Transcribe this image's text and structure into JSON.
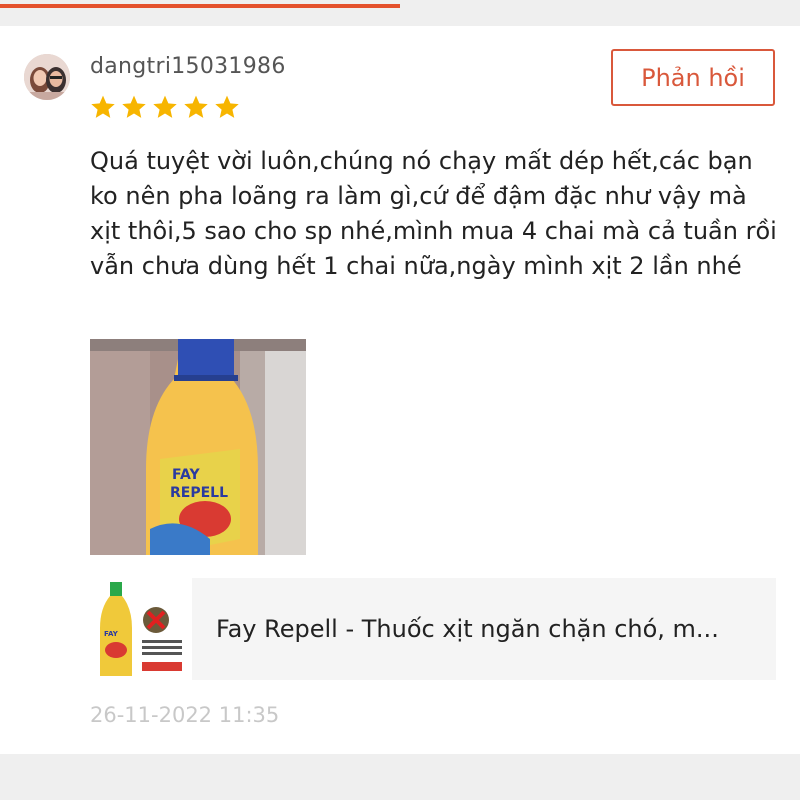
{
  "review": {
    "username": "dangtri15031986",
    "rating": 5,
    "max_rating": 5,
    "text": "Quá tuyệt vời luôn,chúng nó chạy mất dép hết,các bạn ko nên pha loãng ra làm gì,cứ để đậm đặc như vậy mà xịt thôi,5 sao cho sp nhé,mình mua 4 chai mà cả tuần rồi vẫn chưa dùng hết 1 chai nữa,ngày mình xịt 2 lần nhé",
    "date": "26-11-2022 11:35",
    "reply_label": "Phản hồi"
  },
  "product": {
    "name": "Fay Repell - Thuốc xịt ngăn chặn chó, m..."
  },
  "colors": {
    "accent": "#e4512c",
    "star": "#f7b500",
    "date_text": "#c8c8c8"
  }
}
